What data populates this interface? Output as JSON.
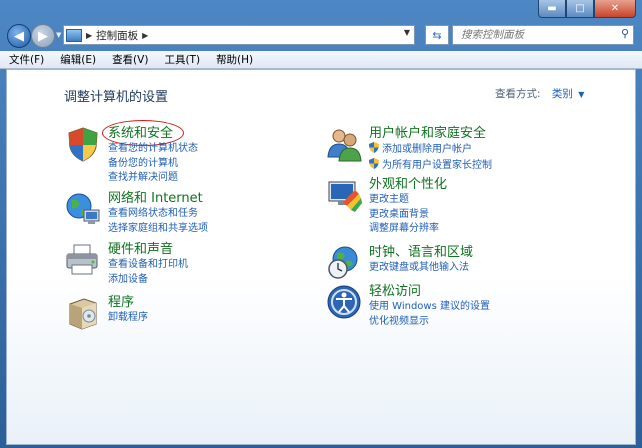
{
  "window": {
    "caption_buttons": [
      {
        "name": "minimize-button",
        "glyph": "▬"
      },
      {
        "name": "maximize-button",
        "glyph": "□"
      },
      {
        "name": "close-button",
        "glyph": "✕"
      }
    ]
  },
  "address_bar": {
    "crumb": "控制面板",
    "search_placeholder": "搜索控制面板",
    "icons": [
      "back-arrow-icon",
      "forward-arrow-icon",
      "control-panel-icon",
      "refresh-icon",
      "search-icon"
    ]
  },
  "menu": [
    "文件(F)",
    "编辑(E)",
    "查看(V)",
    "工具(T)",
    "帮助(H)"
  ],
  "page": {
    "title": "调整计算机的设置",
    "view_by_label": "查看方式:",
    "view_by_value": "类别"
  },
  "categories": {
    "system_security": {
      "title": "系统和安全",
      "icon": "shield-icon",
      "links": [
        "查看您的计算机状态",
        "备份您的计算机",
        "查找并解决问题"
      ]
    },
    "network": {
      "title": "网络和 Internet",
      "icon": "network-globe-icon",
      "links": [
        "查看网络状态和任务",
        "选择家庭组和共享选项"
      ]
    },
    "hardware_sound": {
      "title": "硬件和声音",
      "icon": "printer-icon",
      "links": [
        "查看设备和打印机",
        "添加设备"
      ]
    },
    "programs": {
      "title": "程序",
      "icon": "programs-box-icon",
      "links": [
        "卸载程序"
      ]
    },
    "user_accounts": {
      "title": "用户帐户和家庭安全",
      "icon": "users-icon",
      "links": [
        "添加或删除用户帐户",
        "为所有用户设置家长控制"
      ]
    },
    "appearance": {
      "title": "外观和个性化",
      "icon": "paint-monitor-icon",
      "links": [
        "更改主题",
        "更改桌面背景",
        "调整屏幕分辨率"
      ]
    },
    "clock_region": {
      "title": "时钟、语言和区域",
      "icon": "clock-globe-icon",
      "links": [
        "更改键盘或其他输入法"
      ]
    },
    "ease_access": {
      "title": "轻松访问",
      "icon": "ease-of-access-icon",
      "links": [
        "使用 Windows 建议的设置",
        "优化视频显示"
      ]
    }
  },
  "colors": {
    "category_title": "#0f7320",
    "link": "#1f5fb4",
    "annotation_circle": "#d21a1a"
  }
}
